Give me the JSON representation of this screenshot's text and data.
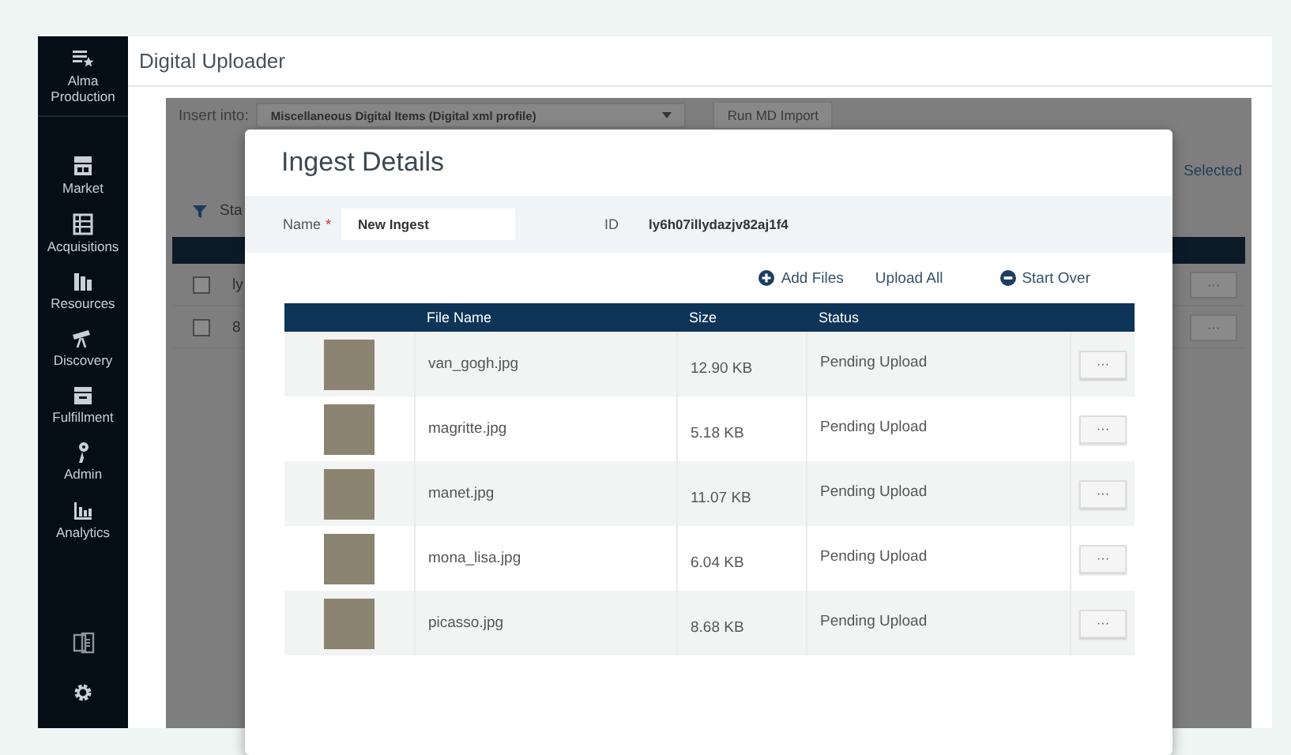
{
  "sidebar": {
    "items": [
      {
        "label": "Alma Production"
      },
      {
        "label": "Market"
      },
      {
        "label": "Acquisitions"
      },
      {
        "label": "Resources"
      },
      {
        "label": "Discovery"
      },
      {
        "label": "Fulfillment"
      },
      {
        "label": "Admin"
      },
      {
        "label": "Analytics"
      }
    ]
  },
  "page_title": "Digital Uploader",
  "background": {
    "insert_label": "Insert into:",
    "profile_select": "Miscellaneous Digital Items (Digital xml profile)",
    "import_button": "Run MD Import",
    "selected_text": "Selected",
    "filter_label": "Sta",
    "rows": [
      {
        "text": "ly",
        "checked": false,
        "menu": "···"
      },
      {
        "text": "8",
        "checked": false,
        "menu": "···"
      }
    ]
  },
  "modal": {
    "title": "Ingest Details",
    "name_label": "Name",
    "required_mark": "*",
    "name_value": "New Ingest",
    "id_label": "ID",
    "id_value": "ly6h07illydazjv82aj1f4",
    "actions": [
      {
        "label": "Add Files",
        "kind": "add"
      },
      {
        "label": "Upload All",
        "kind": "plain"
      },
      {
        "label": "Start Over",
        "kind": "remove"
      }
    ],
    "table": {
      "columns": [
        "File Name",
        "Size",
        "Status"
      ],
      "rows": [
        {
          "file_name": "van_gogh.jpg",
          "size": "12.90 KB",
          "status": "Pending Upload",
          "menu": "···"
        },
        {
          "file_name": "magritte.jpg",
          "size": "5.18 KB",
          "status": "Pending Upload",
          "menu": "···"
        },
        {
          "file_name": "manet.jpg",
          "size": "11.07 KB",
          "status": "Pending Upload",
          "menu": "···"
        },
        {
          "file_name": "mona_lisa.jpg",
          "size": "6.04 KB",
          "status": "Pending Upload",
          "menu": "···"
        },
        {
          "file_name": "picasso.jpg",
          "size": "8.68 KB",
          "status": "Pending Upload",
          "menu": "···"
        }
      ]
    }
  }
}
